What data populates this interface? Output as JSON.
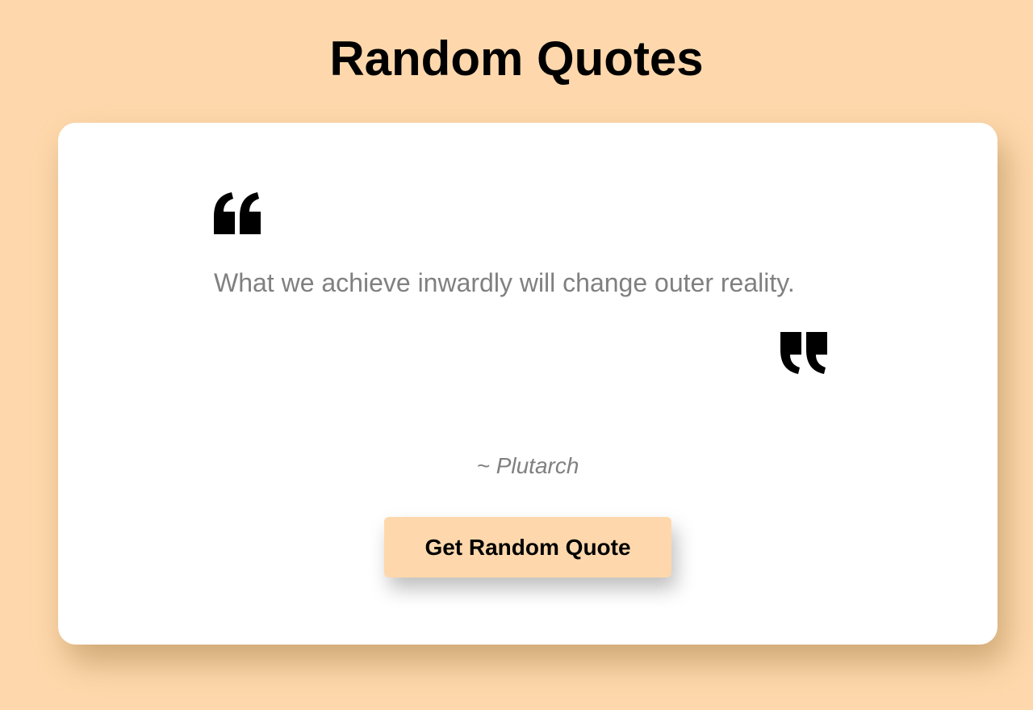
{
  "header": {
    "title": "Random Quotes"
  },
  "quote": {
    "open_icon": "quote-left-icon",
    "text": "What we achieve inwardly will change outer reality.",
    "close_icon": "quote-right-icon",
    "author": "~ Plutarch"
  },
  "actions": {
    "button_label": "Get Random Quote"
  },
  "colors": {
    "background": "#fed8ac",
    "card": "#ffffff",
    "quote_text": "#808080",
    "button_bg": "#fed8ac"
  }
}
